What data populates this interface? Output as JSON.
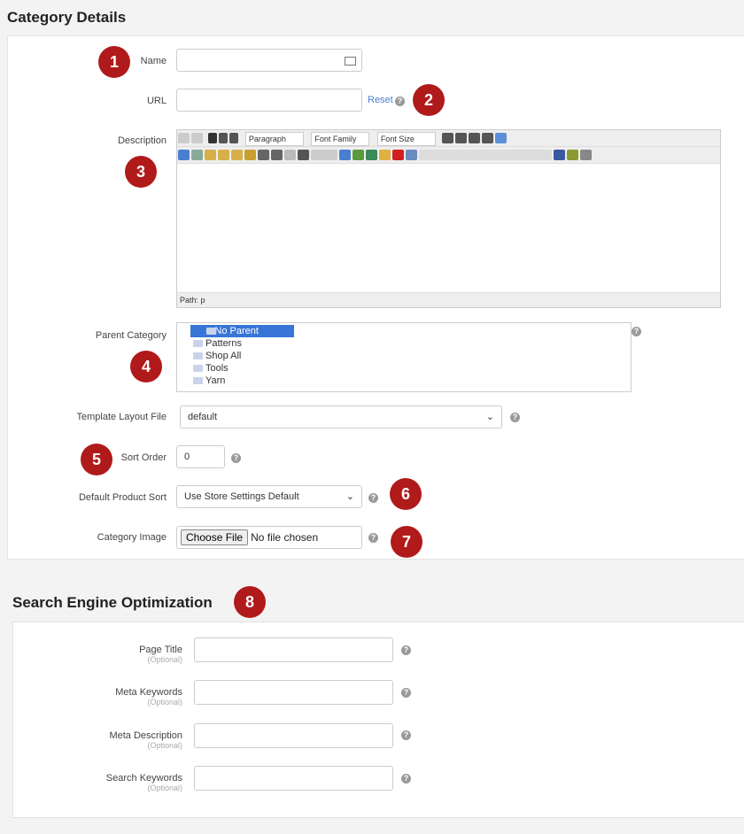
{
  "category": {
    "title": "Category Details",
    "name_label": "Name",
    "url_label": "URL",
    "reset": "Reset",
    "description_label": "Description",
    "editor": {
      "paragraph": "Paragraph",
      "font_family": "Font Family",
      "font_size": "Font Size",
      "path": "Path: p"
    },
    "parent_label": "Parent Category",
    "tree": [
      "-- No Parent Category --",
      "Patterns",
      "Shop All",
      "Tools",
      "Yarn"
    ],
    "template_label": "Template Layout File",
    "template_value": "default",
    "sort_label": "Sort Order",
    "sort_value": "0",
    "product_sort_label": "Default Product Sort",
    "product_sort_value": "Use Store Settings Default",
    "image_label": "Category Image",
    "choose_file": "Choose File",
    "no_file": "No file chosen"
  },
  "seo": {
    "title": "Search Engine Optimization",
    "optional": "(Optional)",
    "fields": [
      "Page Title",
      "Meta Keywords",
      "Meta Description",
      "Search Keywords"
    ]
  },
  "badges": [
    "1",
    "2",
    "3",
    "4",
    "5",
    "6",
    "7",
    "8"
  ],
  "colors": {
    "badge": "#b01a1a",
    "selection": "#3875d7",
    "link": "#4a7fd0"
  }
}
